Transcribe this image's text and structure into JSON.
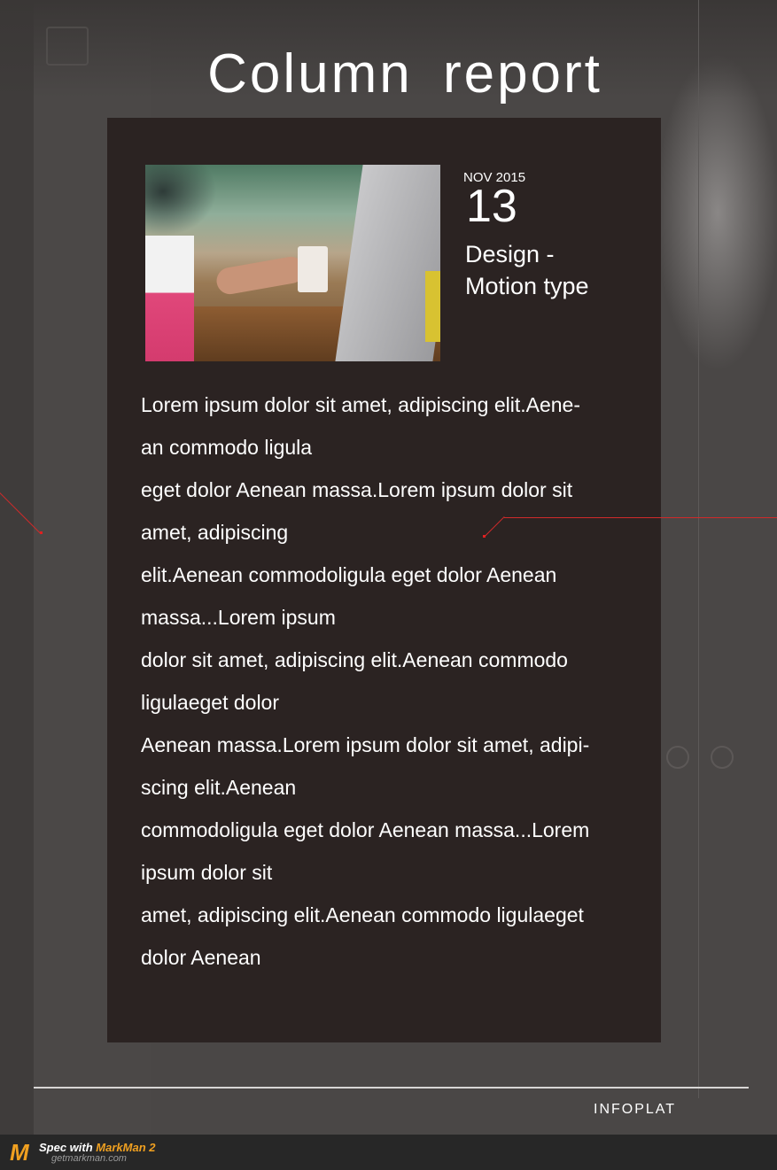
{
  "page": {
    "title": "Column report",
    "accent_color": "#d12a2a",
    "card_background": "#2b2322"
  },
  "article": {
    "month_year": "NOV 2015",
    "day": "13",
    "category": "Design -\nMotion type",
    "photo_icon": "office-desk-photo",
    "body_lines": [
      "Lorem ipsum dolor sit amet, adipiscing elit.Aene-",
      "an commodo ligula",
      "eget dolor Aenean massa.Lorem ipsum dolor sit",
      "amet, adipiscing",
      "elit.Aenean commodoligula eget dolor Aenean",
      "massa...Lorem ipsum",
      "dolor sit amet, adipiscing elit.Aenean commodo",
      "ligulaeget dolor",
      "Aenean massa.Lorem ipsum dolor sit amet, adipi-",
      "scing elit.Aenean",
      "commodoligula eget dolor Aenean massa...Lorem",
      "ipsum dolor sit",
      "amet, adipiscing elit.Aenean commodo ligulaeget",
      "dolor Aenean"
    ]
  },
  "footer": {
    "brand": "INFOPLAT"
  },
  "markman": {
    "spec_prefix": "Spec with ",
    "product": "MarkMan 2",
    "site": "getmarkman.com"
  }
}
